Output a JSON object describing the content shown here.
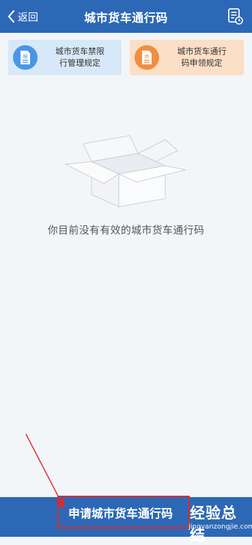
{
  "nav": {
    "back_label": "返回",
    "title": "城市货车通行码",
    "back_icon": "chevron-left-icon",
    "right_icon": "document-clock-icon"
  },
  "cards": [
    {
      "icon": "limit-document-icon",
      "badge": "限",
      "lines": [
        "城市货车禁限",
        "行管理规定"
      ],
      "color": "#d7e9f8"
    },
    {
      "icon": "apply-document-icon",
      "badge": "申",
      "lines": [
        "城市货车通行",
        "码申领规定"
      ],
      "color": "#fbdfc6"
    }
  ],
  "empty": {
    "icon": "empty-box-icon",
    "message": "你目前没有有效的城市货车通行码"
  },
  "footer": {
    "apply_button": "申请城市货车通行码",
    "watermark_text": "经验总结",
    "watermark_url": "jingyanzongjie.com"
  },
  "colors": {
    "primary": "#2c68b5",
    "highlight_border": "#e5262a",
    "annotation_arrow": "#e5262a"
  }
}
